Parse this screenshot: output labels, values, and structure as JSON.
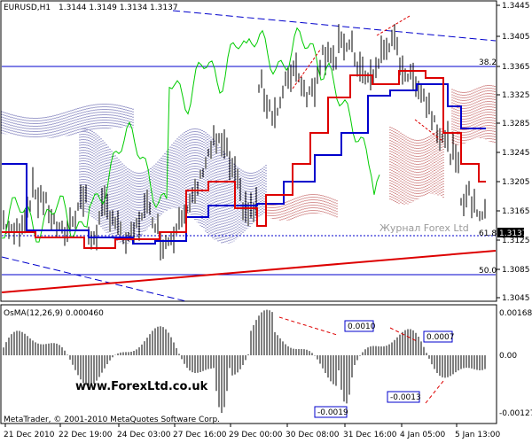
{
  "window": {
    "title": "EURUSD,H1",
    "ohlc": "1.3144 1.3149 1.3134 1.3137"
  },
  "price_axis": {
    "ticks": [
      "1.3445",
      "1.3405",
      "1.3365",
      "1.3325",
      "1.3285",
      "1.3245",
      "1.3205",
      "1.3165",
      "1.3125",
      "1.3085",
      "1.3045"
    ],
    "current_price": "1.3137"
  },
  "fib_levels": [
    {
      "label": "38.2"
    },
    {
      "label": "61.8"
    },
    {
      "label": "50.0"
    }
  ],
  "watermark": "Журнал Forex Ltd",
  "indicator": {
    "title": "OsMA(12,26,9) 0.000460",
    "ticks": [
      "0.00168",
      "0.00",
      "-0.00127"
    ],
    "labels": [
      "0.0010",
      "0.0007",
      "-0.0013",
      "-0.0019"
    ]
  },
  "time_axis": [
    "21 Dec 2010",
    "22 Dec 19:00",
    "24 Dec 03:00",
    "27 Dec 16:00",
    "29 Dec 00:00",
    "30 Dec 08:00",
    "31 Dec 16:00",
    "4 Jan 05:00",
    "5 Jan 13:00"
  ],
  "footer": {
    "url": "www.ForexLtd.co.uk",
    "copyright": "MetaTrader, © 2001-2010 MetaQuotes Software Corp."
  },
  "colors": {
    "accent_blue": "#0000cc",
    "accent_red": "#dd0000",
    "accent_green": "#00cc00",
    "kumo_blue": "#3d3d99",
    "kumo_red": "#b03030",
    "label_box": "#0000cc"
  }
}
